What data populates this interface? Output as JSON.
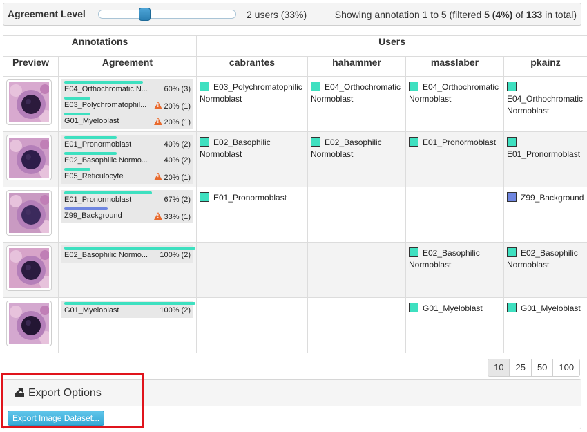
{
  "topbar": {
    "agreement_label": "Agreement Level",
    "users_text": "2 users (33%)",
    "showing_pre": "Showing annotation 1 to 5 (filtered ",
    "showing_filtered": "5 (4%)",
    "showing_mid": " of ",
    "showing_total": "133",
    "showing_post": " in total)",
    "slider_value": 0.33
  },
  "table": {
    "group_annotations": "Annotations",
    "group_users": "Users",
    "col_preview": "Preview",
    "col_agreement": "Agreement",
    "users": [
      "cabrantes",
      "hahammer",
      "masslaber",
      "pkainz"
    ],
    "rows": [
      {
        "agreement": [
          {
            "label": "E04_Orthochromatic N...",
            "pct": "60% (3)",
            "share": 0.6,
            "warn": false,
            "color": "#3ee0c0"
          },
          {
            "label": "E03_Polychromatophil...",
            "pct": "20% (1)",
            "share": 0.2,
            "warn": true,
            "color": "#3ee0c0"
          },
          {
            "label": "G01_Myeloblast",
            "pct": "20% (1)",
            "share": 0.2,
            "warn": true,
            "color": "#3ee0c0"
          }
        ],
        "cells": [
          {
            "text": "E03_Polychromatophilic Normoblast",
            "color": "#3ee0c0"
          },
          {
            "text": "E04_Orthochromatic Normoblast",
            "color": "#3ee0c0"
          },
          {
            "text": "E04_Orthochromatic Normoblast",
            "color": "#3ee0c0"
          },
          {
            "text": "E04_Orthochromatic Normoblast",
            "color": "#3ee0c0"
          }
        ]
      },
      {
        "agreement": [
          {
            "label": "E01_Pronormoblast",
            "pct": "40% (2)",
            "share": 0.4,
            "warn": false,
            "color": "#3ee0c0"
          },
          {
            "label": "E02_Basophilic Normo...",
            "pct": "40% (2)",
            "share": 0.4,
            "warn": false,
            "color": "#3ee0c0"
          },
          {
            "label": "E05_Reticulocyte",
            "pct": "20% (1)",
            "share": 0.2,
            "warn": true,
            "color": "#3ee0c0"
          }
        ],
        "cells": [
          {
            "text": "E02_Basophilic Normoblast",
            "color": "#3ee0c0"
          },
          {
            "text": "E02_Basophilic Normoblast",
            "color": "#3ee0c0"
          },
          {
            "text": "E01_Pronormoblast",
            "color": "#3ee0c0"
          },
          {
            "text": "E01_Pronormoblast",
            "color": "#3ee0c0"
          }
        ]
      },
      {
        "agreement": [
          {
            "label": "E01_Pronormoblast",
            "pct": "67% (2)",
            "share": 0.67,
            "warn": false,
            "color": "#3ee0c0"
          },
          {
            "label": "Z99_Background",
            "pct": "33% (1)",
            "share": 0.33,
            "warn": true,
            "color": "#6f86e0"
          }
        ],
        "cells": [
          {
            "text": "E01_Pronormoblast",
            "color": "#3ee0c0"
          },
          null,
          null,
          {
            "text": "Z99_Background",
            "color": "#6f86e0"
          }
        ]
      },
      {
        "agreement": [
          {
            "label": "E02_Basophilic Normo...",
            "pct": "100% (2)",
            "share": 1.0,
            "warn": false,
            "color": "#3ee0c0"
          }
        ],
        "cells": [
          null,
          null,
          {
            "text": "E02_Basophilic Normoblast",
            "color": "#3ee0c0"
          },
          {
            "text": "E02_Basophilic Normoblast",
            "color": "#3ee0c0"
          }
        ]
      },
      {
        "agreement": [
          {
            "label": "G01_Myeloblast",
            "pct": "100% (2)",
            "share": 1.0,
            "warn": false,
            "color": "#3ee0c0"
          }
        ],
        "cells": [
          null,
          null,
          {
            "text": "G01_Myeloblast",
            "color": "#3ee0c0"
          },
          {
            "text": "G01_Myeloblast",
            "color": "#3ee0c0"
          }
        ]
      }
    ]
  },
  "pager": {
    "sizes": [
      "10",
      "25",
      "50",
      "100"
    ],
    "selected": "10"
  },
  "export": {
    "title": "Export Options",
    "icon": "export-icon",
    "button_label": "Export Image Dataset..."
  }
}
